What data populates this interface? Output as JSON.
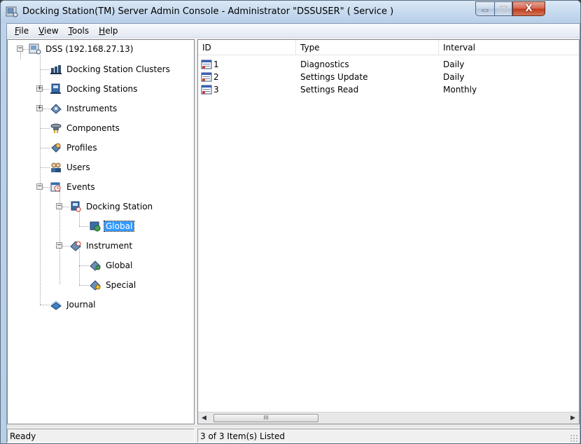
{
  "window": {
    "title": "Docking Station(TM) Server Admin Console - Administrator \"DSSUSER\" ( Service )",
    "close_glyph": "X",
    "min_glyph": "–",
    "max_glyph": "□"
  },
  "menu": {
    "file": {
      "mnemonic": "F",
      "rest": "ile"
    },
    "view": {
      "mnemonic": "V",
      "rest": "iew"
    },
    "tools": {
      "mnemonic": "T",
      "rest": "ools"
    },
    "help": {
      "mnemonic": "H",
      "rest": "elp"
    }
  },
  "tree": {
    "root": "DSS (192.168.27.13)",
    "items": {
      "clusters": "Docking Station Clusters",
      "docking_stations": "Docking Stations",
      "instruments": "Instruments",
      "components": "Components",
      "profiles": "Profiles",
      "users": "Users",
      "events": "Events",
      "events_docking_station": "Docking Station",
      "events_ds_global": "Global",
      "events_instrument": "Instrument",
      "events_inst_global": "Global",
      "events_inst_special": "Special",
      "journal": "Journal"
    },
    "selected": "events_ds_global"
  },
  "list": {
    "columns": [
      "ID",
      "Type",
      "Interval"
    ],
    "rows": [
      {
        "id": "1",
        "type": "Diagnostics",
        "interval": "Daily"
      },
      {
        "id": "2",
        "type": "Settings Update",
        "interval": "Daily"
      },
      {
        "id": "3",
        "type": "Settings Read",
        "interval": "Monthly"
      }
    ],
    "scroll_thumb_glyph": "III",
    "scroll_left": "◀",
    "scroll_right": "▶"
  },
  "status": {
    "left": "Ready",
    "right": "3 of 3 Item(s) Listed"
  },
  "icons": {
    "app": "server-console-icon",
    "event_row": "calendar-event-icon"
  }
}
